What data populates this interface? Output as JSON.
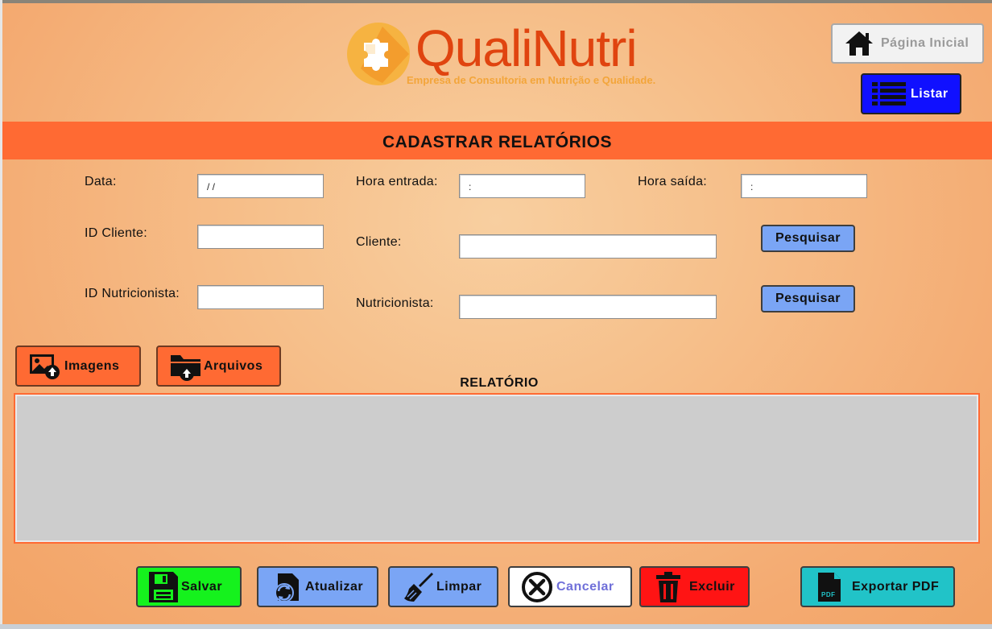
{
  "brand": {
    "name": "QualiNutri",
    "tagline": "Empresa de Consultoria em Nutrição e Qualidade."
  },
  "nav": {
    "home_label": "Página Inicial",
    "list_label": "Listar"
  },
  "page_title": "CADASTRAR RELATÓRIOS",
  "form": {
    "data_label": "Data:",
    "data_value": " / /",
    "hora_entrada_label": "Hora entrada:",
    "hora_entrada_value": ":",
    "hora_saida_label": "Hora saída:",
    "hora_saida_value": ":",
    "id_cliente_label": "ID Cliente:",
    "id_cliente_value": "",
    "cliente_label": "Cliente:",
    "cliente_value": "",
    "id_nutricionista_label": "ID Nutricionista:",
    "id_nutricionista_value": "",
    "nutricionista_label": "Nutricionista:",
    "nutricionista_value": "",
    "pesquisar_label": "Pesquisar"
  },
  "attachments": {
    "imagens_label": "Imagens",
    "arquivos_label": "Arquivos"
  },
  "report": {
    "label": "RELATÓRIO",
    "value": ""
  },
  "actions": {
    "salvar": "Salvar",
    "atualizar": "Atualizar",
    "limpar": "Limpar",
    "cancelar": "Cancelar",
    "excluir": "Excluir",
    "exportar_pdf": "Exportar PDF"
  },
  "colors": {
    "accent_orange": "#ff6a33",
    "list_button_blue": "#1010ff",
    "search_button_blue": "#7aa5f5",
    "save_green": "#15f21d",
    "delete_red": "#ff1414",
    "pdf_teal": "#21c3c8",
    "brand_text": "#e0440f"
  },
  "icons": {
    "home": "home-icon",
    "list": "list-icon",
    "image_upload": "image-upload-icon",
    "folder_upload": "folder-upload-icon",
    "save": "floppy-disk-icon",
    "refresh": "refresh-document-icon",
    "broom": "broom-icon",
    "cancel": "circle-x-icon",
    "trash": "trash-icon",
    "pdf": "pdf-file-icon"
  }
}
